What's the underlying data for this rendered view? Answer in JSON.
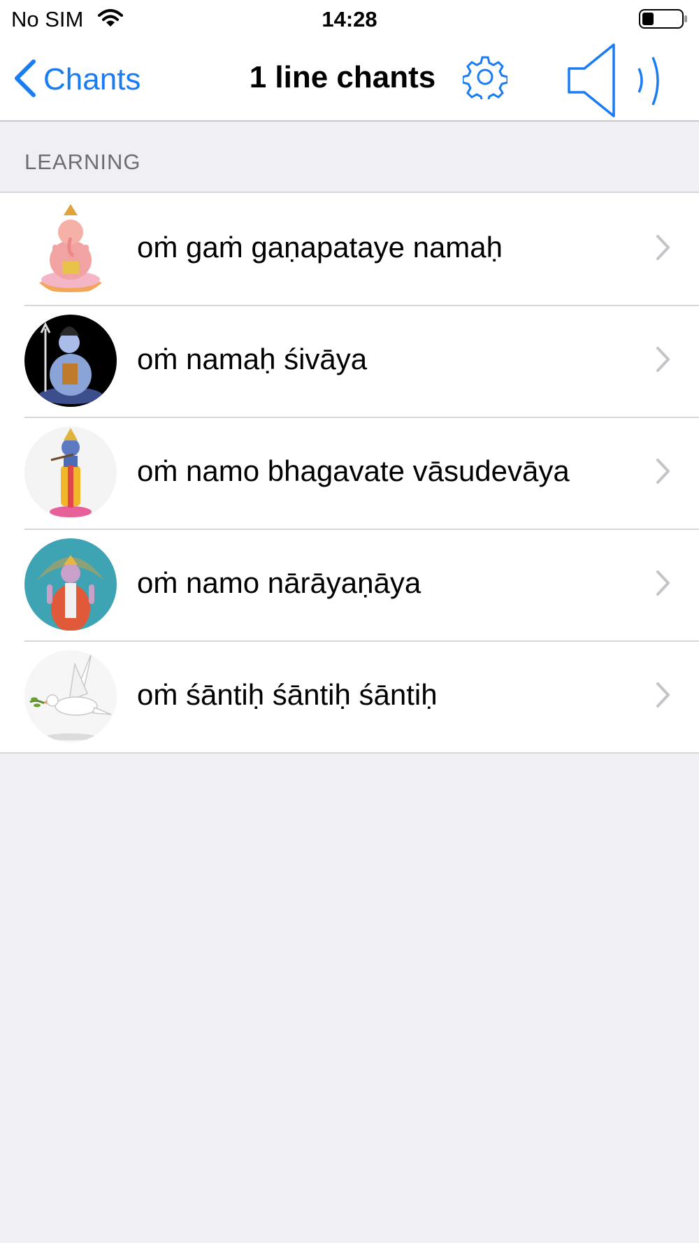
{
  "status_bar": {
    "carrier": "No SIM",
    "time": "14:28",
    "battery_level": 0.3
  },
  "nav": {
    "back_label": "Chants",
    "title": "1 line chants",
    "settings_icon": "gear-icon",
    "audio_icon": "speaker-icon"
  },
  "section": {
    "header": "LEARNING"
  },
  "items": [
    {
      "label": "oṁ gaṁ gaṇapataye namaḥ",
      "image": "ganesha-image"
    },
    {
      "label": "oṁ namaḥ śivāya",
      "image": "shiva-image"
    },
    {
      "label": "oṁ namo bhagavate vāsudevāya",
      "image": "krishna-image"
    },
    {
      "label": "oṁ namo nārāyaṇāya",
      "image": "vishnu-image"
    },
    {
      "label": "oṁ śāntiḥ śāntiḥ śāntiḥ",
      "image": "dove-image"
    }
  ],
  "colors": {
    "accent": "#1a7cf3",
    "background": "#efeff4",
    "separator": "#d8d8dc",
    "section_text": "#6d6d72"
  }
}
